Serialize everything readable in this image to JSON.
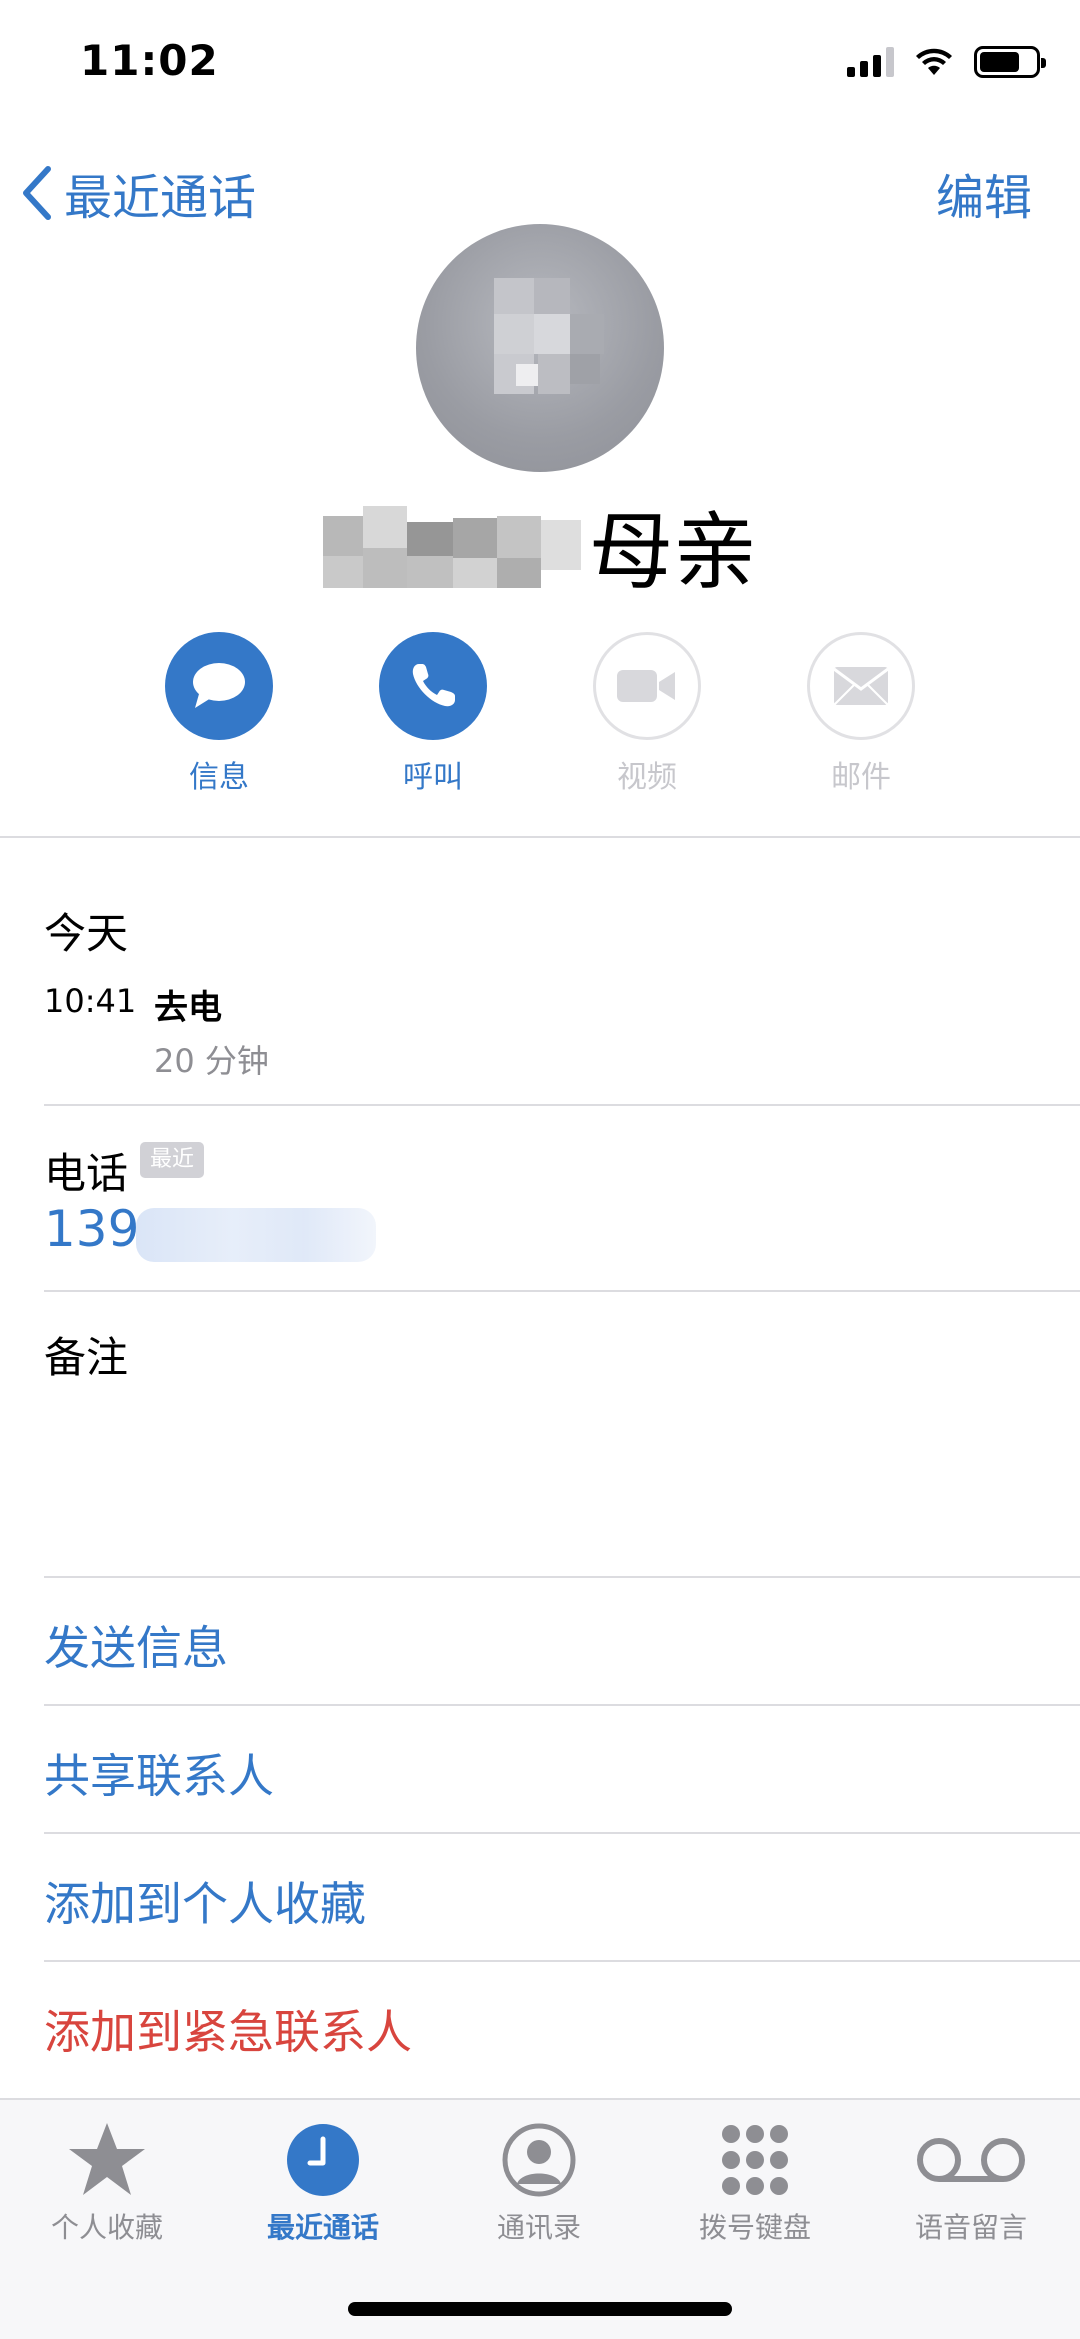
{
  "status_bar": {
    "time": "11:02"
  },
  "nav": {
    "back_label": "最近通话",
    "edit_label": "编辑"
  },
  "contact": {
    "name": "母亲"
  },
  "actions": [
    {
      "label": "信息",
      "icon": "message-icon",
      "enabled": true
    },
    {
      "label": "呼叫",
      "icon": "phone-icon",
      "enabled": true
    },
    {
      "label": "视频",
      "icon": "video-icon",
      "enabled": false
    },
    {
      "label": "邮件",
      "icon": "mail-icon",
      "enabled": false
    }
  ],
  "call_log": {
    "day": "今天",
    "time": "10:41",
    "type": "去电",
    "duration": "20 分钟"
  },
  "phone": {
    "label": "电话",
    "badge": "最近",
    "number_prefix": "139"
  },
  "notes": {
    "label": "备注"
  },
  "links": [
    {
      "label": "发送信息",
      "color": "#3478c8"
    },
    {
      "label": "共享联系人",
      "color": "#3478c8"
    },
    {
      "label": "添加到个人收藏",
      "color": "#3478c8"
    },
    {
      "label": "添加到紧急联系人",
      "color": "#d8453e"
    }
  ],
  "tabs": [
    {
      "label": "个人收藏",
      "icon": "star-icon",
      "active": false
    },
    {
      "label": "最近通话",
      "icon": "clock-icon",
      "active": true
    },
    {
      "label": "通讯录",
      "icon": "contacts-icon",
      "active": false
    },
    {
      "label": "拨号键盘",
      "icon": "keypad-icon",
      "active": false
    },
    {
      "label": "语音留言",
      "icon": "voicemail-icon",
      "active": false
    }
  ],
  "colors": {
    "accent": "#3478c8",
    "destructive": "#d8453e",
    "secondary_text": "#8e8e93"
  }
}
